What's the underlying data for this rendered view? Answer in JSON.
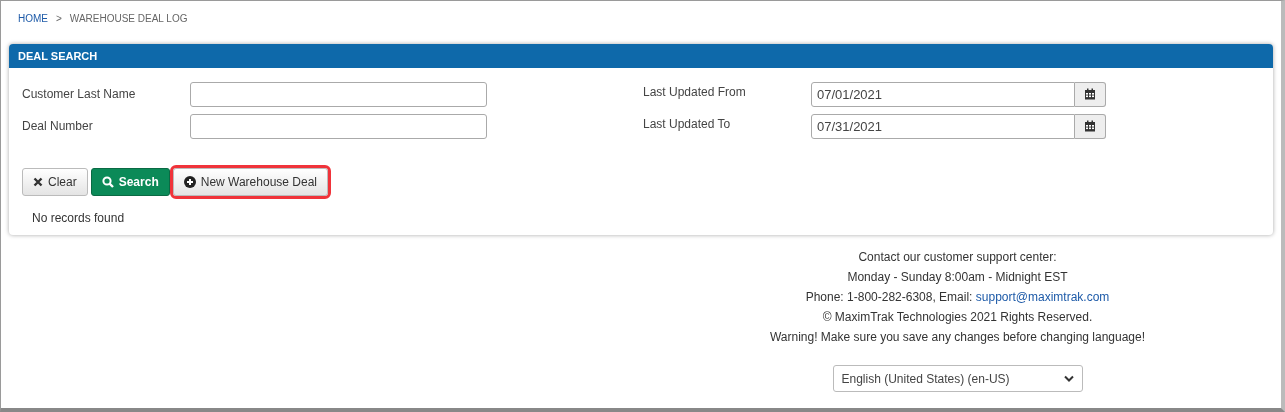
{
  "breadcrumb": [
    {
      "label": "HOME",
      "kind": "link"
    },
    {
      "label": ">",
      "kind": "separator"
    },
    {
      "label": "WAREHOUSE DEAL LOG",
      "kind": "current"
    }
  ],
  "panel": {
    "title": "DEAL SEARCH",
    "left_fields": [
      {
        "label": "Customer Last Name"
      },
      {
        "label": "Deal Number"
      }
    ],
    "right_fields": [
      {
        "label": "Last Updated From",
        "value": "07/01/2021"
      },
      {
        "label": "Last Updated To",
        "value": "07/31/2021"
      }
    ],
    "buttons": [
      {
        "label": "Clear",
        "kind": "clear",
        "highlighted": false
      },
      {
        "label": "Search",
        "kind": "search",
        "highlighted": false
      },
      {
        "label": "New Warehouse Deal",
        "kind": "new",
        "highlighted": true
      }
    ],
    "message": "No records found"
  },
  "footer": {
    "lines": [
      {
        "text": "Contact our customer support center:"
      },
      {
        "text": "Monday - Sunday 8:00am - Midnight EST"
      },
      {
        "text": "Phone: 1-800-282-6308, Email: ",
        "link": "support@maximtrak.com"
      },
      {
        "text": "© MaximTrak Technologies 2021 Rights Reserved."
      },
      {
        "text": "Warning! Make sure you save any changes before changing language!"
      }
    ],
    "language": "English (United States) (en-US)"
  }
}
